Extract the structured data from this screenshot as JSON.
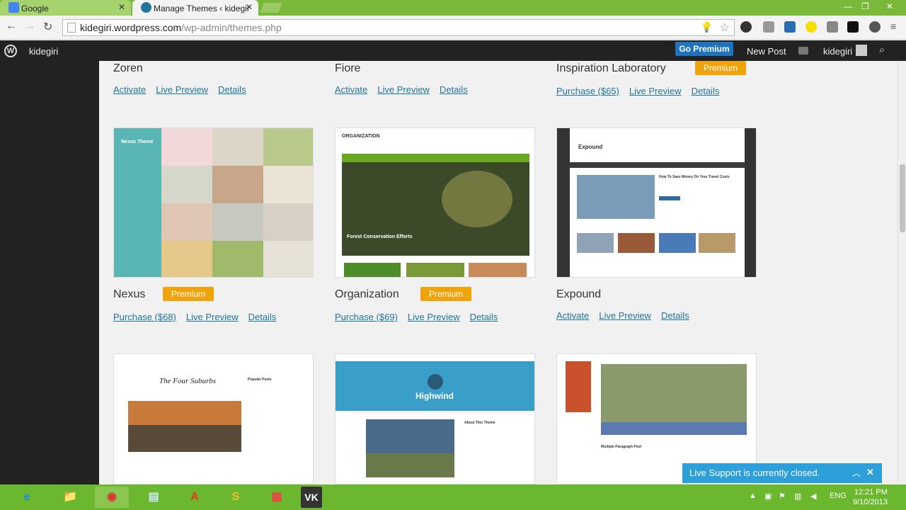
{
  "browser": {
    "tabs": [
      {
        "label": "Google",
        "color": "#4285f4"
      },
      {
        "label": "Manage Themes ‹ kidegir",
        "color": "#21759b"
      }
    ],
    "url_domain": "kidegiri.wordpress.com",
    "url_path": "/wp-admin/themes.php",
    "window_controls": [
      "—",
      "❐",
      "✕"
    ]
  },
  "adminbar": {
    "site": "kidegiri",
    "go_premium": "Go Premium",
    "new_post": "New Post",
    "user": "kidegiri"
  },
  "themes": [
    {
      "name": "Zoren",
      "links": [
        "Activate",
        "Live Preview",
        "Details"
      ]
    },
    {
      "name": "Fiore",
      "links": [
        "Activate",
        "Live Preview",
        "Details"
      ]
    },
    {
      "name": "Inspiration Laboratory",
      "badge": "Premium",
      "links": [
        "Purchase ($65)",
        "Live Preview",
        "Details"
      ]
    },
    {
      "name": "Nexus",
      "badge": "Premium",
      "links": [
        "Purchase ($68)",
        "Live Preview",
        "Details"
      ],
      "shot_title": "Nexus Theme"
    },
    {
      "name": "Organization",
      "badge": "Premium",
      "links": [
        "Purchase ($69)",
        "Live Preview",
        "Details"
      ],
      "shot_title": "ORGANIZATION",
      "shot_caption": "Forest Conservation Efforts"
    },
    {
      "name": "Expound",
      "links": [
        "Activate",
        "Live Preview",
        "Details"
      ],
      "shot_title": "Expound",
      "shot_caption": "How To Save Money On Your Travel Costs"
    },
    {
      "shot_title": "The Four Suburbs",
      "shot_caption": "Popular Posts"
    },
    {
      "shot_title": "Highwind",
      "shot_caption": "About This Theme"
    },
    {
      "shot_caption": "Multiple Paragraph Post"
    }
  ],
  "live_support": {
    "text": "Live Support is currently closed."
  },
  "taskbar": {
    "apps": [
      "e",
      "📁",
      "◉",
      "▤",
      "A",
      "S",
      "▦",
      "VK"
    ],
    "lang": "ENG",
    "time": "12:21 PM",
    "date": "9/10/2013"
  }
}
